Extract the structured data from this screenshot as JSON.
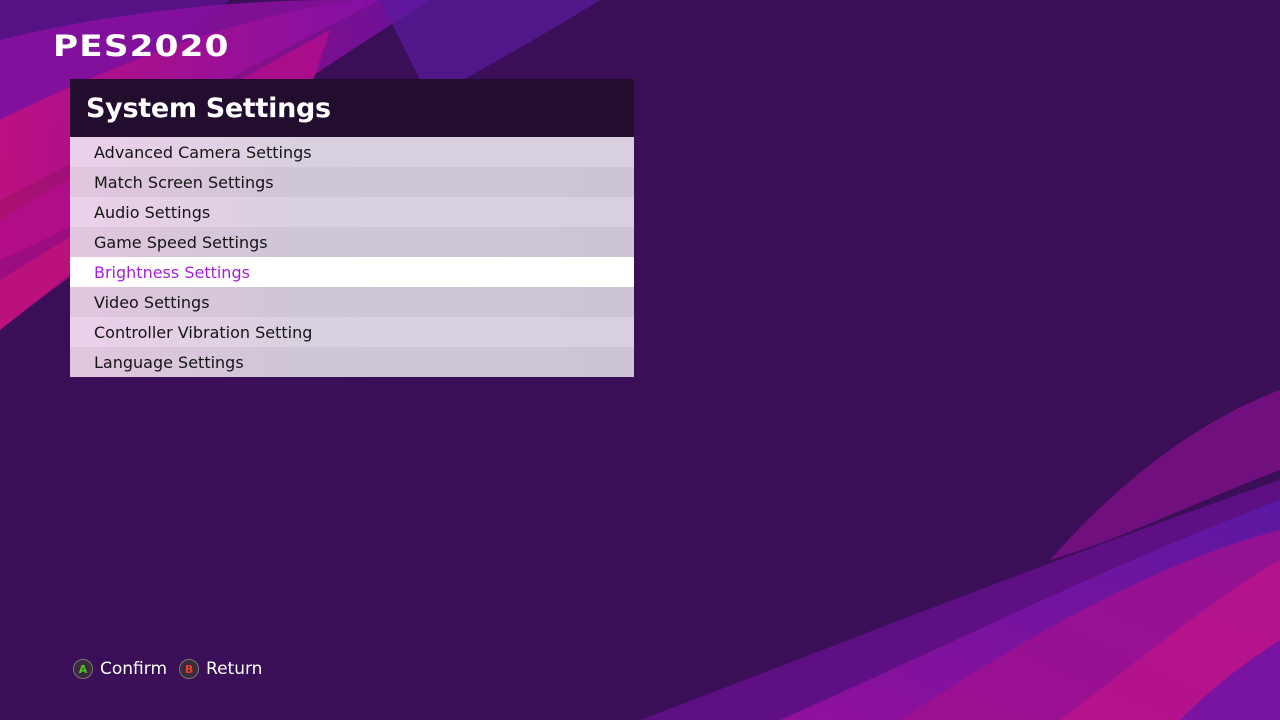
{
  "logo": {
    "text": "PES2020"
  },
  "panel": {
    "title": "System Settings",
    "items": [
      {
        "label": "Advanced Camera Settings"
      },
      {
        "label": "Match Screen Settings"
      },
      {
        "label": "Audio Settings"
      },
      {
        "label": "Game Speed Settings"
      },
      {
        "label": "Brightness Settings",
        "selected": true
      },
      {
        "label": "Video Settings"
      },
      {
        "label": "Controller Vibration Setting"
      },
      {
        "label": "Language Settings"
      }
    ]
  },
  "footer": {
    "confirm": {
      "button": "A",
      "label": "Confirm",
      "color": "#4fc828"
    },
    "return": {
      "button": "B",
      "label": "Return",
      "color": "#e8422a"
    }
  },
  "colors": {
    "background": "#3a0f58",
    "header": "#220d2f",
    "selected_text": "#a61ed8"
  }
}
